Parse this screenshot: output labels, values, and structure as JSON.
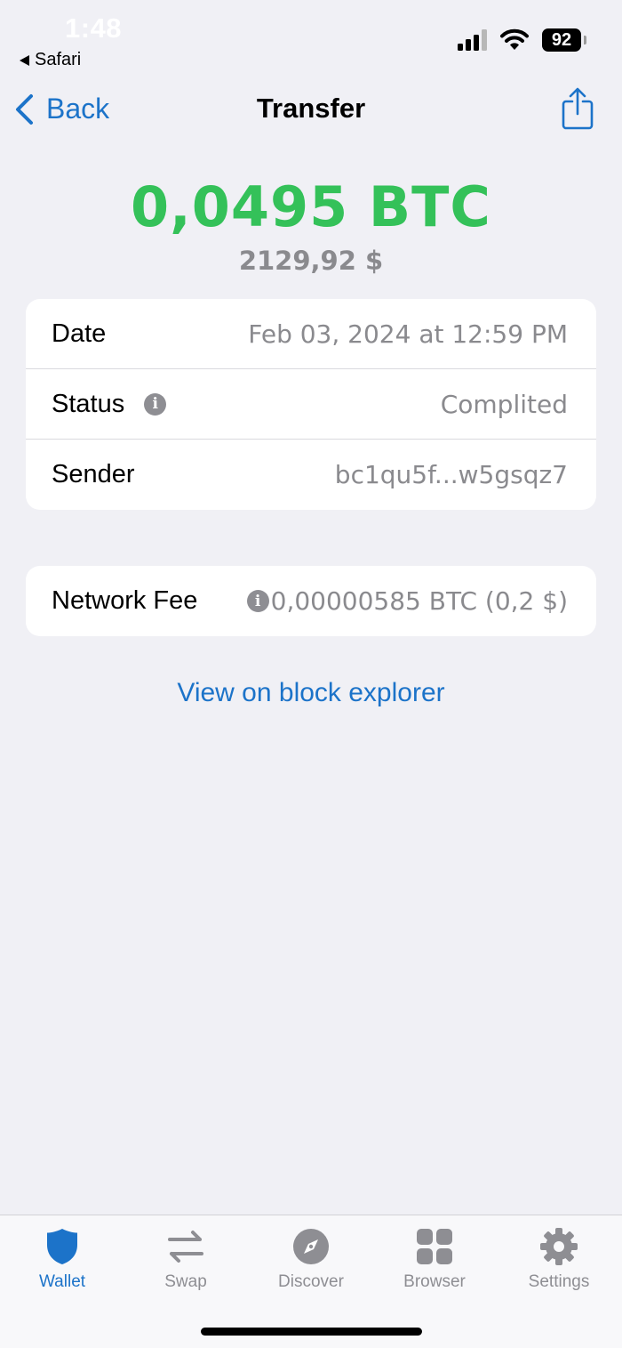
{
  "status_bar": {
    "time": "1:48",
    "back_app": "Safari",
    "battery": "92"
  },
  "nav": {
    "back_label": "Back",
    "title": "Transfer"
  },
  "amount": {
    "crypto": "0,0495 BTC",
    "fiat": "2129,92 $",
    "color": "#34c159"
  },
  "details": [
    {
      "label": "Date",
      "value": "Feb 03, 2024 at 12:59 PM"
    },
    {
      "label": "Status",
      "value": "Complited"
    },
    {
      "label": "Sender",
      "value": "bc1qu5f...w5gsqz7"
    }
  ],
  "fee": {
    "label": "Network Fee",
    "value": "0,00000585 BTC (0,2 $)"
  },
  "explorer_link": "View on block explorer",
  "tabs": [
    {
      "label": "Wallet",
      "icon": "shield-icon",
      "active": true
    },
    {
      "label": "Swap",
      "icon": "swap-arrows-icon",
      "active": false
    },
    {
      "label": "Discover",
      "icon": "compass-icon",
      "active": false
    },
    {
      "label": "Browser",
      "icon": "grid-icon",
      "active": false
    },
    {
      "label": "Settings",
      "icon": "gear-icon",
      "active": false
    }
  ],
  "colors": {
    "accent": "#1c73c9",
    "background": "#f0f0f5",
    "muted": "#8e8e93"
  }
}
